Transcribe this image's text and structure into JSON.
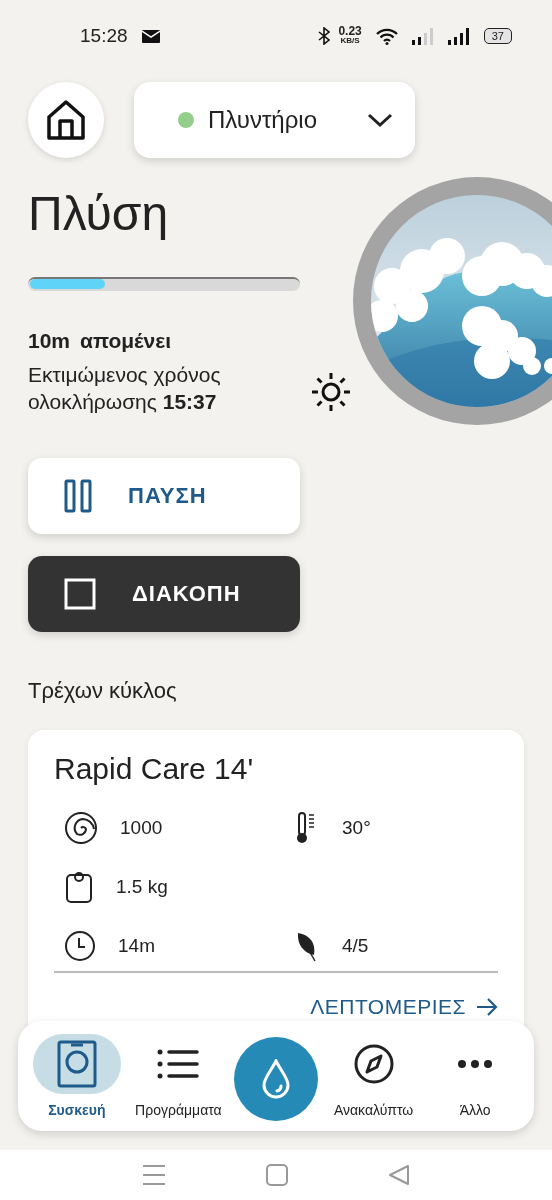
{
  "status_bar": {
    "time": "15:28",
    "net_speed": "0.23",
    "net_unit": "KB/S",
    "battery": "37"
  },
  "device_selector": {
    "name": "Πλυντήριο",
    "color": "#93cf8a"
  },
  "title": "Πλύση",
  "progress": {
    "level": 0.29
  },
  "remaining": {
    "value": "10m",
    "label": "απομένει"
  },
  "estimate": "Εκτιμώμενος χρόνος ολοκλήρωσης **15:37**",
  "actions": [
    {
      "kind": "pause",
      "label": "ΠΑΥΣΗ"
    },
    {
      "kind": "stop",
      "label": "ΔΙΑΚΟΠΗ"
    }
  ],
  "section_title": "Τρέχων κύκλος",
  "cycle": {
    "name": "Rapid Care 14'",
    "rows": [
      [
        {
          "kind": "spin",
          "value": "1000"
        },
        {
          "kind": "temperature",
          "value": "30°"
        }
      ],
      [
        {
          "kind": "load",
          "value": "1.5 kg"
        }
      ],
      [
        {
          "kind": "duration",
          "value": "14m"
        },
        {
          "kind": "eco",
          "value": "4/5"
        }
      ]
    ],
    "details": "ΛΕΠΤΟΜΕΡΙΕΣ"
  },
  "bottom_nav": [
    {
      "kind": "appliance",
      "label": "Συσκευή",
      "selected": true
    },
    {
      "kind": "programs",
      "label": "Προγράμματα",
      "selected": false
    },
    {
      "kind": "discover",
      "label": "Ανακαλύπτω",
      "selected": false
    },
    {
      "kind": "more",
      "label": "Άλλο",
      "selected": false
    }
  ]
}
